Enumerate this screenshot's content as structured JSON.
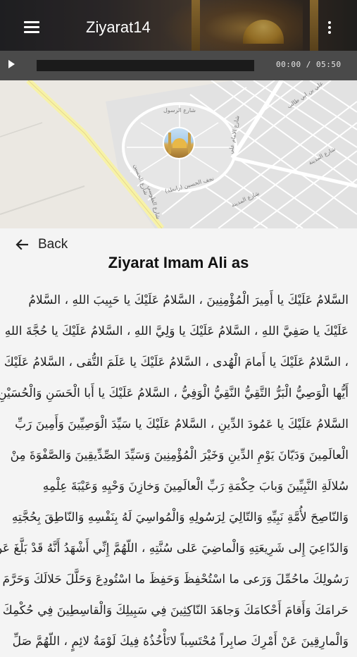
{
  "app": {
    "title": "Ziyarat14"
  },
  "player": {
    "current_time": "00:00",
    "separator": "/",
    "duration": "05:50",
    "progress": 0
  },
  "map": {
    "streets": [
      "شارع الرسول",
      "شارع الامام علي",
      "علي بن ابي طالب",
      "شارع الحسين",
      "شارع المدينة",
      "شارع المدينة",
      "نجف الحسين (رابطة)",
      "شارع الطوسي"
    ]
  },
  "back": {
    "label": "Back"
  },
  "page": {
    "heading": "Ziyarat Imam Ali as"
  },
  "text_lines": [
    "السَّلامُ عَلَيْكَ يا أَمِيرَ الْمُؤْمِنِينَ ، السَّلامُ عَلَيْكَ يا حَبِيبَ اللهِ ، السَّلامُ",
    "عَلَيْكَ يا صَفِيَّ اللهِ ، السَّلامُ عَلَيْكَ يا وَلِيَّ اللهِ ، السَّلامُ عَلَيْكَ يا حُجَّةَ اللهِ",
    "، السَّلامُ عَلَيْكَ يا أَمامَ الْهُدى ، السَّلامُ عَلَيْكَ يا عَلَمَ التُّقى ، السَّلامُ عَلَيْكَ",
    "أَيُّها الْوَصِيُّ الْبَرُّ التَّقِيُّ النَّقِيُّ الْوَفِيُّ ، السَّلامُ عَلَيْكَ يا أَبا الْحَسَنِ وَالْحُسَيْنِ ،",
    "السَّلامُ عَلَيْكَ يا عَمُودَ الدِّينِ ، السَّلامُ عَلَيْكَ يا سَيِّدَ الْوَصِيِّينَ وَأَمِينَ رَبِّ",
    "الْعالَمِينَ وَدَيّانَ يَوْمِ الدِّينِ وَخَيْرَ الْمُؤْمِنِينَ وَسَيِّدَ الصِّدِّيقِينَ وَالصَّفْوَةَ مِنْ",
    "سُلالَةِ النَّبِيِّينَ وَبابَ حِكْمَةِ رَبِّ الْعالَمِينَ وَخازِنَ وَحْيِهِ وَعَيْبَةَ عِلْمِهِ",
    "وَالنّاصِحَ لأُمَّةِ نَبِيِّهِ وَالتّالِيَ لِرَسُولِهِ وَالْمُواسِيَ لَهُ بِنَفْسِهِ وَالنّاطِقَ بِحُجَّتِهِ",
    "وَالدّاعِيَ إِلى شَرِيعَتِهِ وَالْماضِيَ عَلى سُنَّتِهِ ، اللّهُمَّ إِنِّي أَشْهَدُ أَنَّهُ قَدْ بَلَّغَ عَنْ",
    "رَسُولِكَ ماحُمِّلَ وَرَعى ما اسْتُحْفِظَ وَحَفِظَ ما اسْتُودِعَ وَحَلَّلَ حَلالَكَ وَحَرَّمَ",
    "حَرامَكَ وَأَقامَ أَحْكامَكَ وَجاهَدَ النّاكِثِينَ فِي سَبِيلِكَ وَالْقاسِطِينَ فِي حُكْمِكَ",
    "وَالْمارِقِينَ عَنْ أَمْرِكَ صابِراً مُحْتَسِباً لاتَأْخُذُهُ فِيكَ لَوْمَةُ لائِمٍ ، اللّهُمَّ صَلِّ"
  ]
}
